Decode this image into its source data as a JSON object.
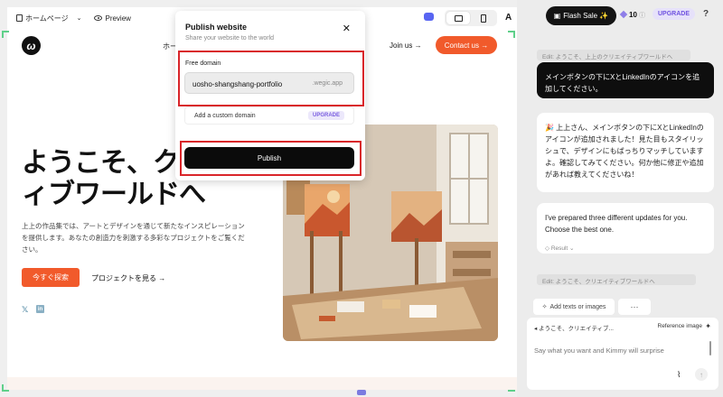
{
  "toolbar": {
    "page_name": "ホームページ",
    "preview_label": "Preview",
    "font_tool": "A"
  },
  "site": {
    "nav_home": "ホー",
    "join_label": "Join us →",
    "contact_label": "Contact us →",
    "hero_title_line1": "ようこそ、クリエ",
    "hero_title_line2": "ィブワールドへ",
    "hero_description": "上上の作品集では、アートとデザインを通じて新たなインスピレーションを提供します。あなたの創造力を刺激する多彩なプロジェクトをご覧ください。",
    "cta_primary": "今すぐ探索",
    "cta_secondary": "プロジェクトを見る →"
  },
  "publish_dialog": {
    "title": "Publish website",
    "subtitle": "Share your website to the world",
    "free_domain_label": "Free domain",
    "domain_value": "uosho-shangshang-portfolio",
    "domain_suffix": ".wegic.app",
    "custom_domain_label": "Add a custom domain",
    "custom_domain_badge": "UPGRADE",
    "publish_label": "Publish"
  },
  "panel": {
    "flash_sale_label": "Flash Sale ✨",
    "credits": "10",
    "upgrade_label": "UPGRADE",
    "help_label": "?"
  },
  "chat": {
    "edit_chip_1": "Edit: ようこそ、上上のクリエイティブワールドへ",
    "user_message": "メインボタンの下にXとLinkedInのアイコンを追加してください。",
    "ai_message": "🎉 上上さん、メインボタンの下にXとLinkedInのアイコンが追加されました！見た目もスタイリッシュで、デザインにもばっちりマッチしていますよ。確認してみてください。何か他に修正や追加があれば教えてくださいね！",
    "ai_message_2": "I've prepared three different updates for you. Choose the best one.",
    "result_label": "Result",
    "edit_chip_2": "Edit: ようこそ、クリエイティブワールドへ"
  },
  "composer": {
    "add_texts_label": "Add texts or images",
    "more_label": "···",
    "context_label": "ようこそ、クリエイティブ...",
    "reference_image_label": "Reference image",
    "placeholder": "Say what you want and Kimmy will surprise"
  },
  "colors": {
    "brand_orange": "#f15a2b",
    "highlight_red": "#d9252a",
    "accent_purple": "#7a5ee0",
    "canvas_corner_green": "#5fd08a"
  }
}
